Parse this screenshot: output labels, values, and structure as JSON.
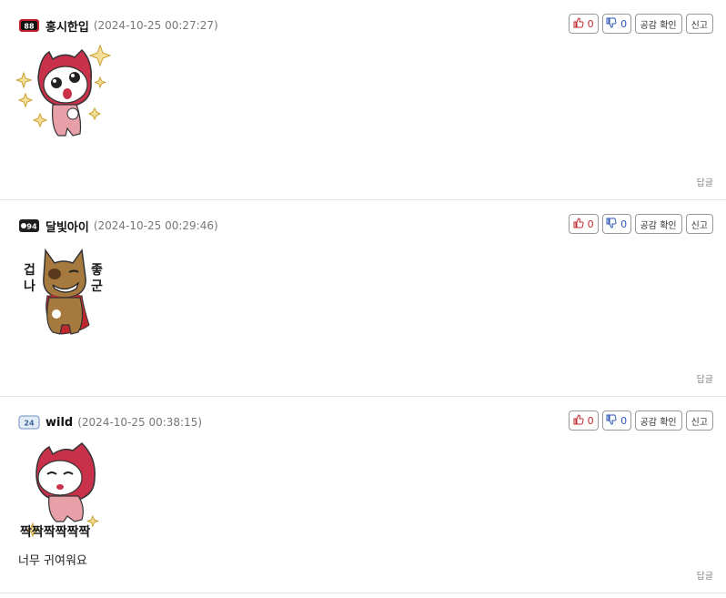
{
  "comments": [
    {
      "level": "88",
      "nickname": "홍시한입",
      "date": "(2024-10-25 00:27:27)",
      "likes": "0",
      "dislikes": "0",
      "empathy_label": "공감 확인",
      "report_label": "신고",
      "reply_label": "답글",
      "text": ""
    },
    {
      "level": "94",
      "nickname": "달빛아이",
      "date": "(2024-10-25 00:29:46)",
      "likes": "0",
      "dislikes": "0",
      "empathy_label": "공감 확인",
      "report_label": "신고",
      "reply_label": "답글",
      "sticker_caption_left": "겁나",
      "sticker_caption_right": "좋군",
      "text": ""
    },
    {
      "level": "24",
      "nickname": "wild",
      "date": "(2024-10-25 00:38:15)",
      "likes": "0",
      "dislikes": "0",
      "empathy_label": "공감 확인",
      "report_label": "신고",
      "reply_label": "답글",
      "sticker_caption": "짝짝짝짝짝짝",
      "text": "너무 귀여워요"
    }
  ],
  "colors": {
    "like": "#c0282f",
    "dislike": "#2a55b5",
    "sticker_red": "#c9304a",
    "sticker_pink": "#e8a0a8",
    "sticker_brown": "#a67a3e"
  }
}
